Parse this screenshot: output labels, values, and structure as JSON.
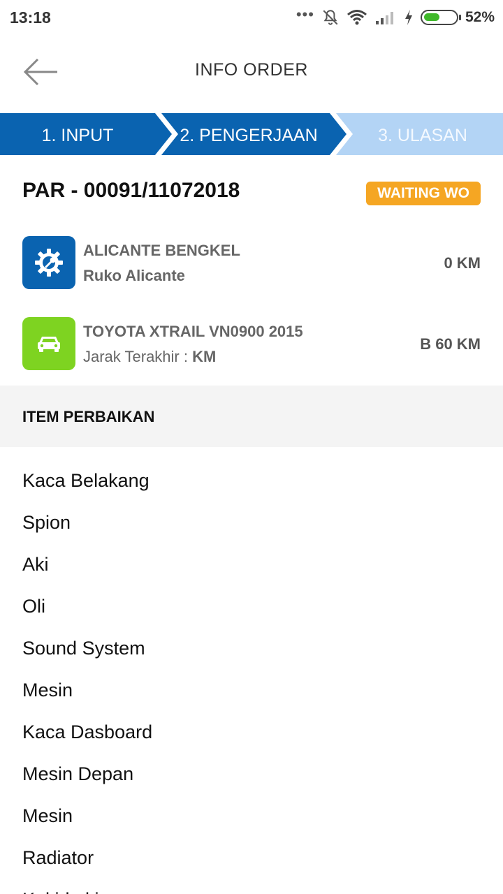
{
  "status_bar": {
    "time": "13:18",
    "battery_percent": "52%",
    "battery_level": 0.52,
    "icons": [
      "more-dots-icon",
      "notifications-off-icon",
      "wifi-icon",
      "signal-icon",
      "charging-bolt-icon",
      "battery-icon"
    ]
  },
  "app_bar": {
    "title": "INFO ORDER",
    "back_icon": "arrow-left-icon"
  },
  "stepper": {
    "steps": [
      {
        "label": "1. INPUT",
        "state": "completed"
      },
      {
        "label": "2. PENGERJAAN",
        "state": "active"
      },
      {
        "label": "3. ULASAN",
        "state": "pending"
      }
    ],
    "colors": {
      "active": "#0a63b0",
      "pending": "#b3d4f5"
    }
  },
  "order": {
    "number": "PAR - 00091/11072018",
    "status": "WAITING WO",
    "status_color": "#f5a623"
  },
  "workshop": {
    "icon": "gear-wrench-icon",
    "icon_bg": "#0a63b0",
    "name": "ALICANTE BENGKEL",
    "address": "Ruko Alicante",
    "distance": "0 KM"
  },
  "vehicle": {
    "icon": "car-icon",
    "icon_bg": "#7ed321",
    "name": "TOYOTA XTRAIL VN0900 2015",
    "last_distance_label": "Jarak Terakhir :",
    "last_distance_value": "KM",
    "plate": "B 60 KM"
  },
  "section": {
    "title": "ITEM PERBAIKAN"
  },
  "items": [
    "Kaca Belakang",
    "Spion",
    "Aki",
    "Oli",
    "Sound System",
    "Mesin",
    "Kaca Dasboard",
    "Mesin Depan",
    "Mesin",
    "Radiator",
    "Kaki-kaki"
  ]
}
